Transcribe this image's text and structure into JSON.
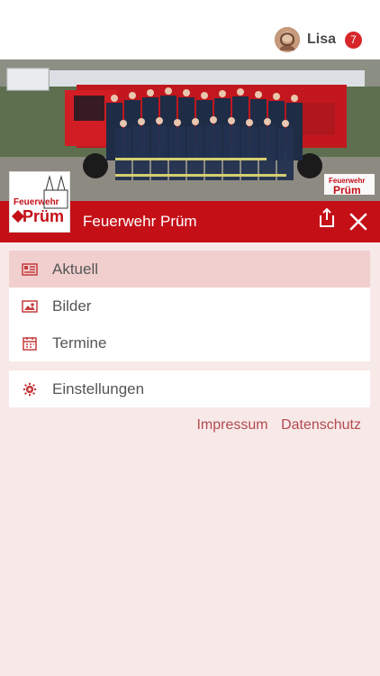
{
  "header": {
    "user": {
      "name": "Lisa",
      "notification_count": "7"
    }
  },
  "brand": {
    "title": "Feuerwehr Prüm",
    "logo": {
      "line1": "Feuerwehr",
      "line2": "Prüm"
    }
  },
  "menu": {
    "items": [
      {
        "label": "Aktuell",
        "icon": "news-icon",
        "active": true
      },
      {
        "label": "Bilder",
        "icon": "image-icon",
        "active": false
      },
      {
        "label": "Termine",
        "icon": "calendar-icon",
        "active": false
      }
    ],
    "settings": {
      "label": "Einstellungen",
      "icon": "gear-icon"
    }
  },
  "footer_links": {
    "impressum": "Impressum",
    "datenschutz": "Datenschutz"
  },
  "colors": {
    "brand_red": "#c40f17",
    "background": "#f8e9e9",
    "active_item": "#f1cfcf",
    "link": "#b24b4f"
  }
}
